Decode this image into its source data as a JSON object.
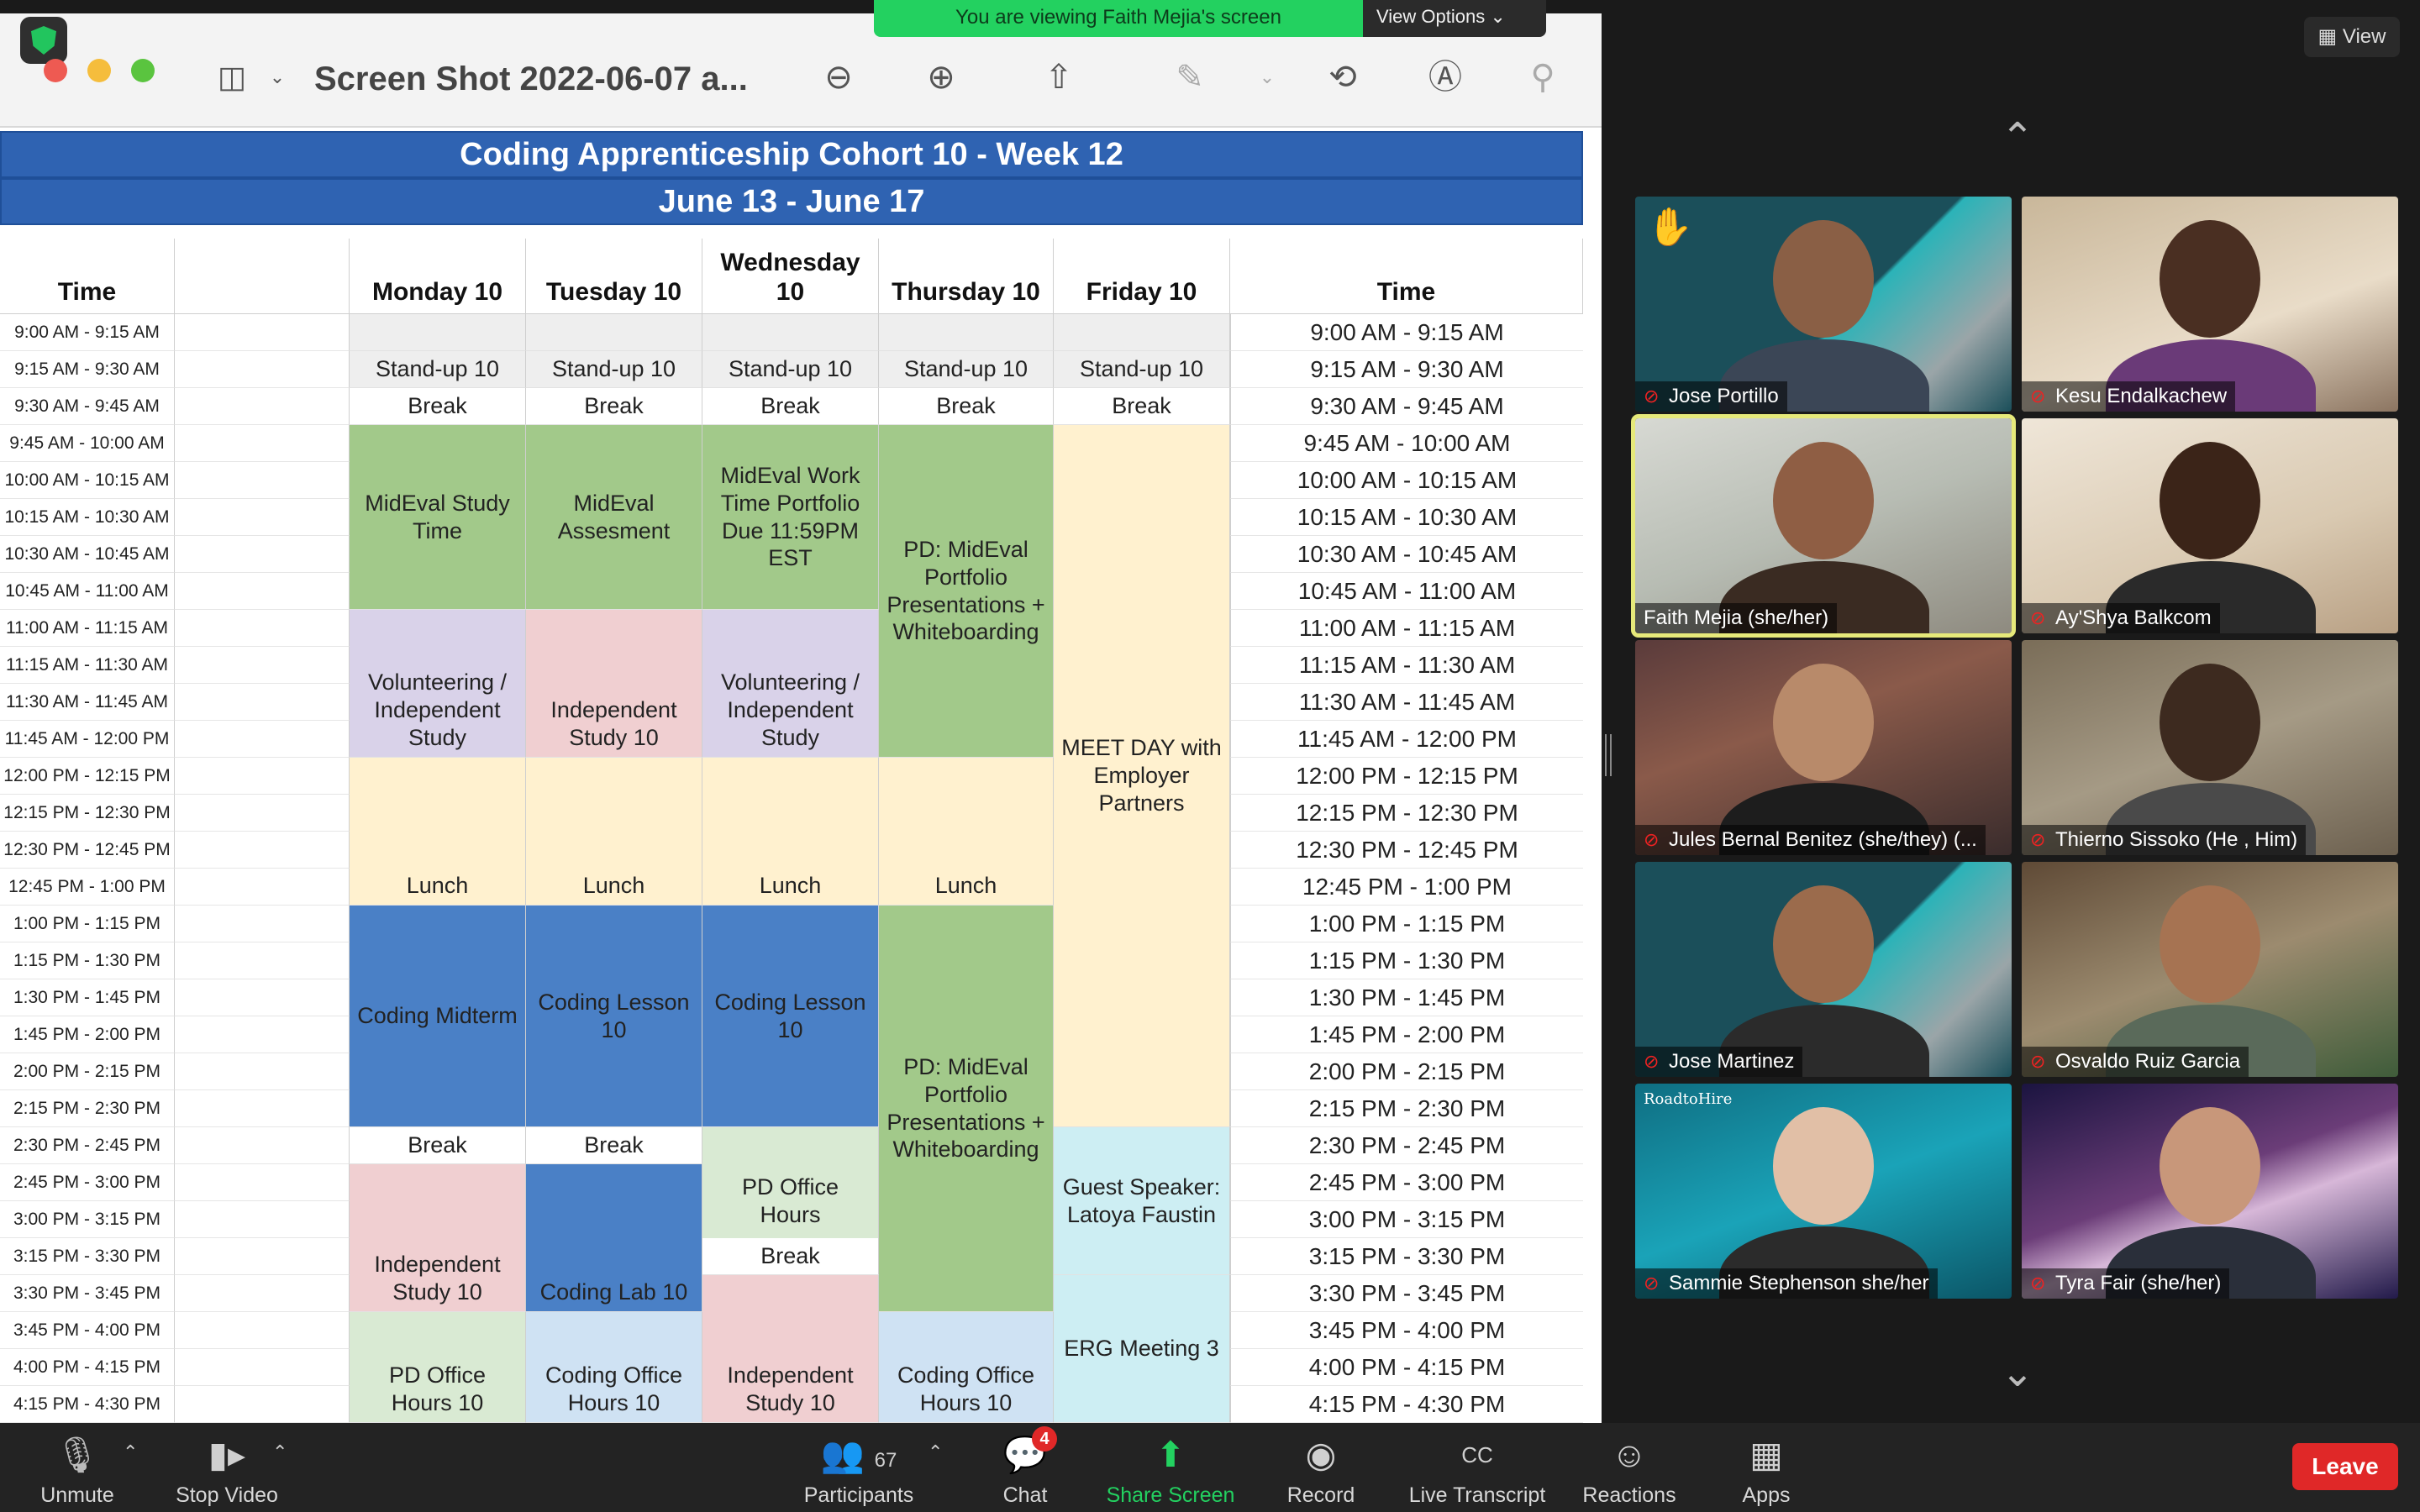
{
  "app": {
    "viewing_banner": "You are viewing Faith Mejia's screen",
    "view_options": "View Options",
    "view_button": "View"
  },
  "preview": {
    "doc_title": "Screen Shot 2022-06-07 a..."
  },
  "sheet": {
    "title": "Coding Apprenticeship Cohort 10 - Week 12",
    "subtitle": "June 13 - June 17",
    "headers": {
      "time_left": "Time",
      "monday": "Monday 10",
      "tuesday": "Tuesday 10",
      "wednesday": "Wednesday\n10",
      "thursday": "Thursday 10",
      "friday": "Friday 10",
      "time_right": "Time"
    },
    "times_left": [
      "9:00 AM - 9:15 AM",
      "9:15 AM - 9:30 AM",
      "9:30 AM - 9:45 AM",
      "9:45 AM - 10:00 AM",
      "10:00 AM - 10:15 AM",
      "10:15 AM - 10:30 AM",
      "10:30 AM - 10:45 AM",
      "10:45 AM - 11:00 AM",
      "11:00 AM - 11:15 AM",
      "11:15 AM - 11:30 AM",
      "11:30 AM - 11:45 AM",
      "11:45 AM - 12:00 PM",
      "12:00 PM - 12:15 PM",
      "12:15 PM - 12:30 PM",
      "12:30 PM - 12:45 PM",
      "12:45 PM - 1:00 PM",
      "1:00 PM - 1:15 PM",
      "1:15 PM - 1:30 PM",
      "1:30 PM - 1:45 PM",
      "1:45 PM - 2:00 PM",
      "2:00 PM - 2:15 PM",
      "2:15 PM - 2:30 PM",
      "2:30 PM - 2:45 PM",
      "2:45 PM - 3:00 PM",
      "3:00 PM - 3:15 PM",
      "3:15 PM - 3:30 PM",
      "3:30 PM - 3:45 PM",
      "3:45 PM - 4:00 PM",
      "4:00 PM - 4:15 PM",
      "4:15 PM - 4:30 PM"
    ],
    "times_right": [
      "9:00 AM - 9:15 AM",
      "9:15 AM - 9:30 AM",
      "9:30 AM - 9:45 AM",
      "9:45 AM - 10:00 AM",
      "10:00 AM - 10:15 AM",
      "10:15 AM - 10:30 AM",
      "10:30 AM - 10:45 AM",
      "10:45 AM - 11:00 AM",
      "11:00 AM - 11:15 AM",
      "11:15 AM - 11:30 AM",
      "11:30 AM - 11:45 AM",
      "11:45 AM - 12:00 PM",
      "12:00 PM - 12:15 PM",
      "12:15 PM - 12:30 PM",
      "12:30 PM - 12:45 PM",
      "12:45 PM - 1:00 PM",
      "1:00 PM - 1:15 PM",
      "1:15 PM - 1:30 PM",
      "1:30 PM - 1:45 PM",
      "1:45 PM - 2:00 PM",
      "2:00 PM - 2:15 PM",
      "2:15 PM - 2:30 PM",
      "2:30 PM - 2:45 PM",
      "2:45 PM - 3:00 PM",
      "3:00 PM - 3:15 PM",
      "3:15 PM - 3:30 PM",
      "3:30 PM - 3:45 PM",
      "3:45 PM - 4:00 PM",
      "4:00 PM - 4:15 PM",
      "4:15 PM - 4:30 PM"
    ],
    "cells": {
      "standup": "Stand-up 10",
      "break": "Break",
      "lunch": "Lunch",
      "mon_mideval": "MidEval Study\nTime",
      "tue_mideval": "MidEval\nAssesment",
      "wed_mideval": "MidEval Work\nTime Portfolio\nDue 11:59PM\nEST",
      "thu_pd1": "PD: MidEval\nPortfolio\nPresentations +\nWhiteboarding",
      "fri_meet": "MEET DAY with\nEmployer\nPartners",
      "mon_vol": "Volunteering /\nIndependent\nStudy",
      "tue_indep": "Independent\nStudy 10",
      "wed_vol": "Volunteering /\nIndependent\nStudy",
      "mon_midterm": "Coding Midterm",
      "tue_lesson": "Coding Lesson\n10",
      "wed_lesson": "Coding Lesson\n10",
      "thu_pd2": "PD: MidEval\nPortfolio\nPresentations +\nWhiteboarding",
      "wed_pdoffice": "PD Office\nHours",
      "fri_guest": "Guest Speaker:\nLatoya Faustin",
      "mon_indep": "Independent\nStudy 10",
      "tue_lab": "Coding Lab 10",
      "fri_erg": "ERG Meeting 3",
      "mon_pdoffice": "PD Office\nHours 10",
      "tue_codingoffice": "Coding Office\nHours 10",
      "wed_indep": "Independent\nStudy 10",
      "thu_codingoffice": "Coding Office\nHours 10"
    },
    "colors": {
      "header_blue": "#2f63b2",
      "green": "#a2c98a",
      "blue": "#4a80c6",
      "pink": "#f0cfd1",
      "lavender": "#d9d2e9",
      "cream": "#fff1cf",
      "light_blue": "#cfe2f3",
      "cyan": "#cdeef3",
      "light_green": "#d9ead3",
      "grey": "#eeeeee"
    }
  },
  "participants": [
    {
      "name": "Jose Portillo",
      "muted": true,
      "hand_raised": true
    },
    {
      "name": "Kesu Endalkachew",
      "muted": true
    },
    {
      "name": "Faith Mejia  (she/her)",
      "muted": false,
      "active_speaker": true
    },
    {
      "name": "Ay'Shya Balkcom",
      "muted": true
    },
    {
      "name": "Jules Bernal Benitez (she/they)  (...",
      "muted": true
    },
    {
      "name": "Thierno Sissoko  (He , Him)",
      "muted": true
    },
    {
      "name": "Jose Martinez",
      "muted": true
    },
    {
      "name": "Osvaldo Ruiz Garcia",
      "muted": true
    },
    {
      "name": "Sammie Stephenson she/her",
      "muted": true
    },
    {
      "name": "Tyra Fair (she/her)",
      "muted": true
    }
  ],
  "tile_brand_text": "RoadtoHire",
  "toolbar": {
    "unmute": "Unmute",
    "stop_video": "Stop Video",
    "participants_count": "67",
    "participants": "Participants",
    "chat": "Chat",
    "chat_badge": "4",
    "share_screen": "Share Screen",
    "record": "Record",
    "live_transcript": "Live Transcript",
    "reactions": "Reactions",
    "apps": "Apps",
    "leave": "Leave"
  }
}
